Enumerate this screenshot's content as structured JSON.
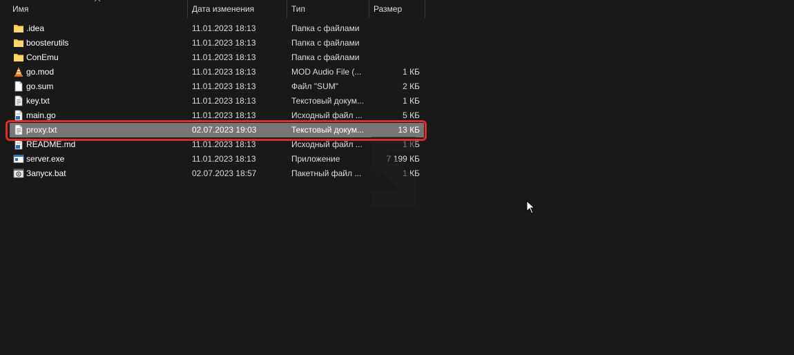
{
  "columns": {
    "name": "Имя",
    "date": "Дата изменения",
    "type": "Тип",
    "size": "Размер"
  },
  "files": [
    {
      "name": ".idea",
      "date": "11.01.2023 18:13",
      "type": "Папка с файлами",
      "size": "",
      "icon": "folder-icon"
    },
    {
      "name": "boosterutils",
      "date": "11.01.2023 18:13",
      "type": "Папка с файлами",
      "size": "",
      "icon": "folder-icon"
    },
    {
      "name": "ConEmu",
      "date": "11.01.2023 18:13",
      "type": "Папка с файлами",
      "size": "",
      "icon": "folder-icon"
    },
    {
      "name": "go.mod",
      "date": "11.01.2023 18:13",
      "type": "MOD Audio File (...",
      "size": "1 КБ",
      "icon": "vlc-cone-icon"
    },
    {
      "name": "go.sum",
      "date": "11.01.2023 18:13",
      "type": "Файл \"SUM\"",
      "size": "2 КБ",
      "icon": "blank-file-icon"
    },
    {
      "name": "key.txt",
      "date": "11.01.2023 18:13",
      "type": "Текстовый докум...",
      "size": "1 КБ",
      "icon": "text-file-icon"
    },
    {
      "name": "main.go",
      "date": "11.01.2023 18:13",
      "type": "Исходный файл ...",
      "size": "5 КБ",
      "icon": "source-file-icon"
    },
    {
      "name": "proxy.txt",
      "date": "02.07.2023 19:03",
      "type": "Текстовый докум...",
      "size": "13 КБ",
      "icon": "text-file-icon",
      "selected": true
    },
    {
      "name": "README.md",
      "date": "11.01.2023 18:13",
      "type": "Исходный файл ...",
      "size": "1 КБ",
      "icon": "source-file-icon"
    },
    {
      "name": "server.exe",
      "date": "11.01.2023 18:13",
      "type": "Приложение",
      "size": "7 199 КБ",
      "icon": "exe-file-icon"
    },
    {
      "name": "Запуск.bat",
      "date": "02.07.2023 18:57",
      "type": "Пакетный файл ...",
      "size": "1 КБ",
      "icon": "batch-file-icon"
    }
  ],
  "colors": {
    "background": "#191919",
    "selection": "#777777",
    "highlight": "#e02b2b",
    "folder": "#f5c443"
  }
}
